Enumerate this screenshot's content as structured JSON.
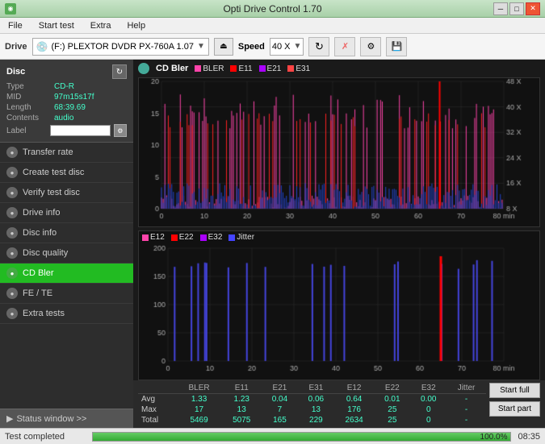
{
  "titleBar": {
    "title": "Opti Drive Control 1.70",
    "icon": "◉",
    "minBtn": "─",
    "maxBtn": "□",
    "closeBtn": "✕"
  },
  "menuBar": {
    "items": [
      "File",
      "Start test",
      "Extra",
      "Help"
    ]
  },
  "driveBar": {
    "label": "Drive",
    "driveValue": "(F:)  PLEXTOR DVDR  PX-760A 1.07",
    "speedLabel": "Speed",
    "speedValue": "40 X"
  },
  "sidebar": {
    "discPanel": {
      "title": "Disc",
      "typeLabel": "Type",
      "typeValue": "CD-R",
      "midLabel": "MID",
      "midValue": "97m15s17f",
      "lengthLabel": "Length",
      "lengthValue": "68:39.69",
      "contentsLabel": "Contents",
      "contentsValue": "audio",
      "labelLabel": "Label"
    },
    "navItems": [
      {
        "id": "transfer-rate",
        "label": "Transfer rate",
        "active": false
      },
      {
        "id": "create-test-disc",
        "label": "Create test disc",
        "active": false
      },
      {
        "id": "verify-test-disc",
        "label": "Verify test disc",
        "active": false
      },
      {
        "id": "drive-info",
        "label": "Drive info",
        "active": false
      },
      {
        "id": "disc-info",
        "label": "Disc info",
        "active": false
      },
      {
        "id": "disc-quality",
        "label": "Disc quality",
        "active": false
      },
      {
        "id": "cd-bler",
        "label": "CD Bler",
        "active": true
      },
      {
        "id": "fe-te",
        "label": "FE / TE",
        "active": false
      },
      {
        "id": "extra-tests",
        "label": "Extra tests",
        "active": false
      }
    ],
    "statusWindowBtn": "Status window >>"
  },
  "chart1": {
    "title": "CD Bler",
    "legend": [
      {
        "label": "BLER",
        "color": "#ff44aa"
      },
      {
        "label": "E11",
        "color": "#ff0000"
      },
      {
        "label": "E21",
        "color": "#aa00ff"
      },
      {
        "label": "E31",
        "color": "#ff4444"
      }
    ],
    "yMax": 20,
    "yAxisLabels": [
      "20",
      "15",
      "10",
      "5",
      "0"
    ],
    "rightAxisLabels": [
      "48 X",
      "40 X",
      "32 X",
      "24 X",
      "16 X",
      "8 X"
    ],
    "xMax": 80
  },
  "chart2": {
    "legend": [
      {
        "label": "E12",
        "color": "#ff44aa"
      },
      {
        "label": "E22",
        "color": "#ff0000"
      },
      {
        "label": "E32",
        "color": "#aa00ff"
      },
      {
        "label": "Jitter",
        "color": "#4444ff"
      }
    ],
    "yMax": 200,
    "xMax": 80
  },
  "stats": {
    "columns": [
      "",
      "BLER",
      "E11",
      "E21",
      "E31",
      "E12",
      "E22",
      "E32",
      "Jitter"
    ],
    "rows": [
      {
        "label": "Avg",
        "values": [
          "1.33",
          "1.23",
          "0.04",
          "0.06",
          "0.64",
          "0.01",
          "0.00",
          "-"
        ]
      },
      {
        "label": "Max",
        "values": [
          "17",
          "13",
          "7",
          "13",
          "176",
          "25",
          "0",
          "-"
        ]
      },
      {
        "label": "Total",
        "values": [
          "5469",
          "5075",
          "165",
          "229",
          "2634",
          "25",
          "0",
          "-"
        ]
      }
    ],
    "startFullBtn": "Start full",
    "startPartBtn": "Start part"
  },
  "bottomBar": {
    "statusText": "Test completed",
    "progressPercent": 100,
    "progressLabel": "100.0%",
    "timeText": "08:35"
  }
}
